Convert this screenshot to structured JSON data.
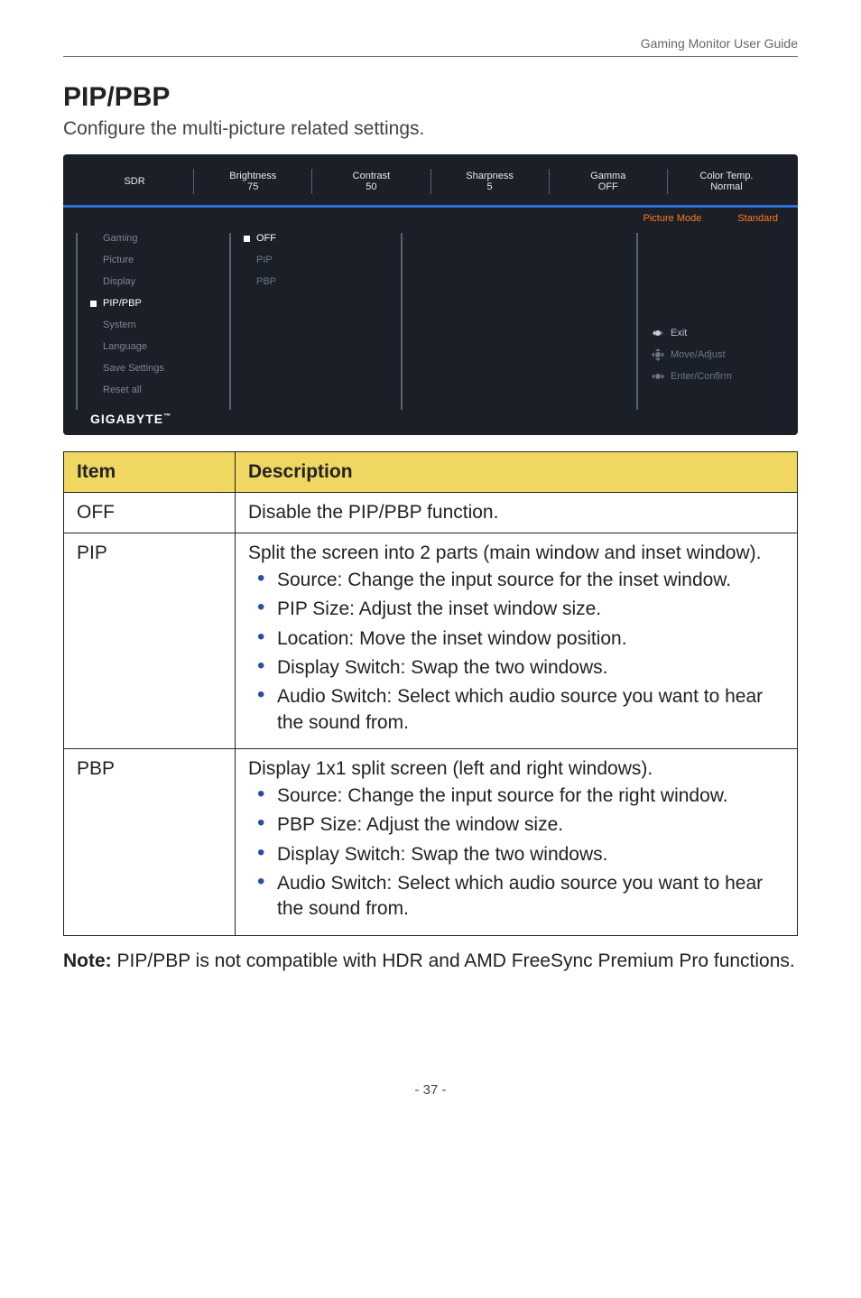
{
  "header": {
    "guide_title": "Gaming Monitor User Guide"
  },
  "section": {
    "title": "PIP/PBP",
    "description": "Configure the multi-picture related settings."
  },
  "osd": {
    "top": [
      {
        "label": "SDR",
        "value": ""
      },
      {
        "label": "Brightness",
        "value": "75"
      },
      {
        "label": "Contrast",
        "value": "50"
      },
      {
        "label": "Sharpness",
        "value": "5"
      },
      {
        "label": "Gamma",
        "value": "OFF"
      },
      {
        "label": "Color Temp.",
        "value": "Normal"
      }
    ],
    "picture_mode_label": "Picture Mode",
    "picture_mode_value": "Standard",
    "nav": [
      {
        "label": "Gaming",
        "active": false
      },
      {
        "label": "Picture",
        "active": false
      },
      {
        "label": "Display",
        "active": false
      },
      {
        "label": "PIP/PBP",
        "active": true
      },
      {
        "label": "System",
        "active": false
      },
      {
        "label": "Language",
        "active": false
      },
      {
        "label": "Save Settings",
        "active": false
      },
      {
        "label": "Reset all",
        "active": false
      }
    ],
    "options": [
      {
        "label": "OFF",
        "selected": true
      },
      {
        "label": "PIP",
        "selected": false
      },
      {
        "label": "PBP",
        "selected": false
      }
    ],
    "brand": "GIGABYTE",
    "hints": {
      "exit": "Exit",
      "move": "Move/Adjust",
      "enter": "Enter/Confirm"
    }
  },
  "table": {
    "head_item": "Item",
    "head_desc": "Description",
    "rows": {
      "off": {
        "name": "OFF",
        "desc": "Disable the PIP/PBP function."
      },
      "pip": {
        "name": "PIP",
        "intro": "Split the screen into 2 parts (main window and inset window).",
        "bullets": [
          "Source:  Change the input source for the inset window.",
          "PIP Size: Adjust the inset window size.",
          "Location:  Move the inset window position.",
          "Display Switch: Swap the two windows.",
          "Audio Switch: Select which audio source you want to hear the sound from."
        ]
      },
      "pbp": {
        "name": "PBP",
        "intro": "Display 1x1 split screen (left and right windows).",
        "bullets": [
          "Source: Change the input source for the right window.",
          "PBP Size: Adjust the window size.",
          "Display Switch: Swap the two windows.",
          "Audio Switch: Select which audio source you want to hear the sound from."
        ]
      }
    }
  },
  "note": {
    "label": "Note:",
    "text": " PIP/PBP is not compatible with HDR and AMD FreeSync Premium Pro functions."
  },
  "footer": {
    "page_number": "- 37 -"
  }
}
